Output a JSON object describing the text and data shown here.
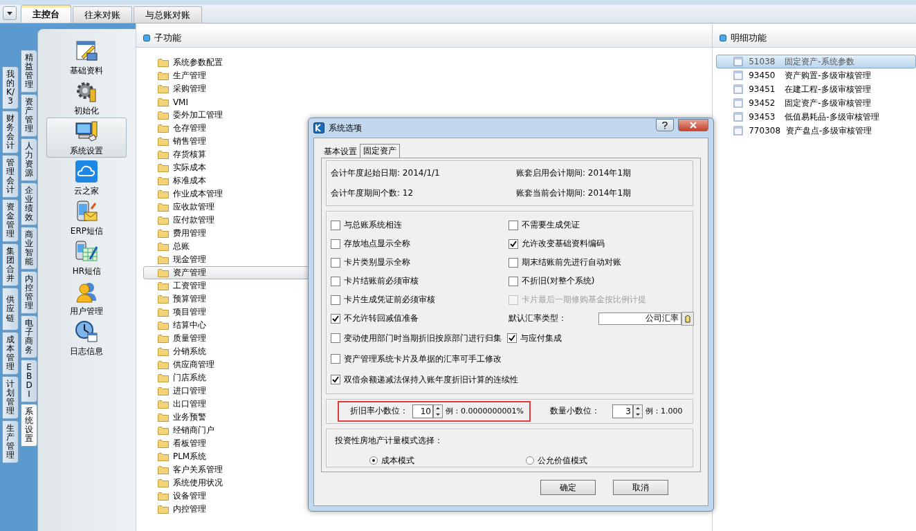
{
  "top_tabs": [
    {
      "label": "主控台",
      "selected": true
    },
    {
      "label": "往来对账",
      "selected": false
    },
    {
      "label": "与总账对账",
      "selected": false
    }
  ],
  "outer_side_tabs": [
    {
      "label": "我的K/3",
      "selected": false
    },
    {
      "label": "财务会计",
      "selected": false
    },
    {
      "label": "管理会计",
      "selected": false
    },
    {
      "label": "资金管理",
      "selected": false
    },
    {
      "label": "集团合并",
      "selected": false
    },
    {
      "label": "供应链",
      "selected": false
    },
    {
      "label": "成本管理",
      "selected": false
    },
    {
      "label": "计划管理",
      "selected": false
    },
    {
      "label": "生产管理",
      "selected": false
    }
  ],
  "inner_side_tabs": [
    {
      "label": "精益管理",
      "selected": false
    },
    {
      "label": "资产管理",
      "selected": false
    },
    {
      "label": "人力资源",
      "selected": false
    },
    {
      "label": "企业绩效",
      "selected": false
    },
    {
      "label": "商业智能",
      "selected": false
    },
    {
      "label": "内控管理",
      "selected": false
    },
    {
      "label": "电子商务",
      "selected": false
    },
    {
      "label": "EBDI",
      "selected": false
    },
    {
      "label": "系统设置",
      "selected": true
    }
  ],
  "launcher": [
    {
      "label": "基础资料",
      "selected": false
    },
    {
      "label": "初始化",
      "selected": false
    },
    {
      "label": "系统设置",
      "selected": true
    },
    {
      "label": "云之家",
      "selected": false
    },
    {
      "label": "ERP短信",
      "selected": false
    },
    {
      "label": "HR短信",
      "selected": false
    },
    {
      "label": "用户管理",
      "selected": false
    },
    {
      "label": "日志信息",
      "selected": false
    }
  ],
  "sub_functions": {
    "title": "子功能",
    "items": [
      {
        "label": "系统参数配置",
        "selected": false
      },
      {
        "label": "生产管理",
        "selected": false
      },
      {
        "label": "采购管理",
        "selected": false
      },
      {
        "label": "VMI",
        "selected": false
      },
      {
        "label": "委外加工管理",
        "selected": false
      },
      {
        "label": "仓存管理",
        "selected": false
      },
      {
        "label": "销售管理",
        "selected": false
      },
      {
        "label": "存货核算",
        "selected": false
      },
      {
        "label": "实际成本",
        "selected": false
      },
      {
        "label": "标准成本",
        "selected": false
      },
      {
        "label": "作业成本管理",
        "selected": false
      },
      {
        "label": "应收款管理",
        "selected": false
      },
      {
        "label": "应付款管理",
        "selected": false
      },
      {
        "label": "费用管理",
        "selected": false
      },
      {
        "label": "总账",
        "selected": false
      },
      {
        "label": "现金管理",
        "selected": false
      },
      {
        "label": "资产管理",
        "selected": true
      },
      {
        "label": "工资管理",
        "selected": false
      },
      {
        "label": "预算管理",
        "selected": false
      },
      {
        "label": "项目管理",
        "selected": false
      },
      {
        "label": "结算中心",
        "selected": false
      },
      {
        "label": "质量管理",
        "selected": false
      },
      {
        "label": "分销系统",
        "selected": false
      },
      {
        "label": "供应商管理",
        "selected": false
      },
      {
        "label": "门店系统",
        "selected": false
      },
      {
        "label": "进口管理",
        "selected": false
      },
      {
        "label": "出口管理",
        "selected": false
      },
      {
        "label": "业务预警",
        "selected": false
      },
      {
        "label": "经销商门户",
        "selected": false
      },
      {
        "label": "看板管理",
        "selected": false
      },
      {
        "label": "PLM系统",
        "selected": false
      },
      {
        "label": "客户关系管理",
        "selected": false
      },
      {
        "label": "系统使用状况",
        "selected": false
      },
      {
        "label": "设备管理",
        "selected": false
      },
      {
        "label": "内控管理",
        "selected": false
      }
    ]
  },
  "detail_functions": {
    "title": "明细功能",
    "items": [
      {
        "code": "51038",
        "name": "固定资产-系统参数",
        "selected": true
      },
      {
        "code": "93450",
        "name": "资产购置-多级审核管理",
        "selected": false
      },
      {
        "code": "93451",
        "name": "在建工程-多级审核管理",
        "selected": false
      },
      {
        "code": "93452",
        "name": "固定资产-多级审核管理",
        "selected": false
      },
      {
        "code": "93453",
        "name": "低值易耗品-多级审核管理",
        "selected": false
      },
      {
        "code": "770308",
        "name": "资产盘点-多级审核管理",
        "selected": false
      }
    ]
  },
  "dialog": {
    "title": "系统选项",
    "tabs": [
      {
        "label": "基本设置",
        "selected": false
      },
      {
        "label": "固定资产",
        "selected": true
      }
    ],
    "info": [
      "会计年度起始日期: 2014/1/1",
      "账套启用会计期间: 2014年1期",
      "会计年度期间个数: 12",
      "账套当前会计期间: 2014年1期"
    ],
    "option_rows": [
      {
        "kind": "pair",
        "items": [
          {
            "kind": "checkbox",
            "label": "与总账系统相连",
            "checked": false,
            "disabled": false
          },
          {
            "kind": "checkbox",
            "label": "不需要生成凭证",
            "checked": false,
            "disabled": false
          }
        ]
      },
      {
        "kind": "pair",
        "items": [
          {
            "kind": "checkbox",
            "label": "存放地点显示全称",
            "checked": false,
            "disabled": false
          },
          {
            "kind": "checkbox",
            "label": "允许改变基础资料编码",
            "checked": true,
            "disabled": false
          }
        ]
      },
      {
        "kind": "pair",
        "items": [
          {
            "kind": "checkbox",
            "label": "卡片类别显示全称",
            "checked": false,
            "disabled": false
          },
          {
            "kind": "checkbox",
            "label": "期末结账前先进行自动对账",
            "checked": false,
            "disabled": false
          }
        ]
      },
      {
        "kind": "pair",
        "items": [
          {
            "kind": "checkbox",
            "label": "卡片结账前必须审核",
            "checked": false,
            "disabled": false
          },
          {
            "kind": "checkbox",
            "label": "不折旧(对整个系统)",
            "checked": false,
            "disabled": false
          }
        ]
      },
      {
        "kind": "pair",
        "items": [
          {
            "kind": "checkbox",
            "label": "卡片生成凭证前必须审核",
            "checked": false,
            "disabled": false
          },
          {
            "kind": "checkbox",
            "label": "卡片最后一期修购基金按比例计提",
            "checked": false,
            "disabled": true
          }
        ]
      },
      {
        "kind": "pair",
        "items": [
          {
            "kind": "checkbox",
            "label": "不允许转回减值准备",
            "checked": true,
            "disabled": false
          },
          {
            "kind": "field",
            "label": "默认汇率类型：",
            "value": "公司汇率"
          }
        ]
      },
      {
        "kind": "line",
        "items": [
          {
            "kind": "checkbox",
            "label": "变动使用部门时当期折旧按原部门进行归集",
            "checked": false,
            "disabled": false
          },
          {
            "kind": "checkbox",
            "label": "与应付集成",
            "checked": true,
            "disabled": false
          }
        ]
      },
      {
        "kind": "line",
        "items": [
          {
            "kind": "checkbox",
            "label": "资产管理系统卡片及单据的汇率可手工修改",
            "checked": false,
            "disabled": false
          }
        ]
      },
      {
        "kind": "line",
        "items": [
          {
            "kind": "checkbox",
            "label": "双倍余额递减法保持入账年度折旧计算的连续性",
            "checked": true,
            "disabled": false
          }
        ]
      }
    ],
    "decimals": [
      {
        "label": "折旧率小数位：",
        "value": "10",
        "example": "例：0.0000000001%",
        "highlighted": true
      },
      {
        "label": "数量小数位：",
        "value": "3",
        "example": "例：1.000",
        "highlighted": false
      }
    ],
    "property_mode": {
      "title": "投资性房地产计量模式选择：",
      "options": [
        {
          "label": "成本模式",
          "selected": true
        },
        {
          "label": "公允价值模式",
          "selected": false
        }
      ]
    },
    "buttons": [
      "确定",
      "取消"
    ]
  }
}
